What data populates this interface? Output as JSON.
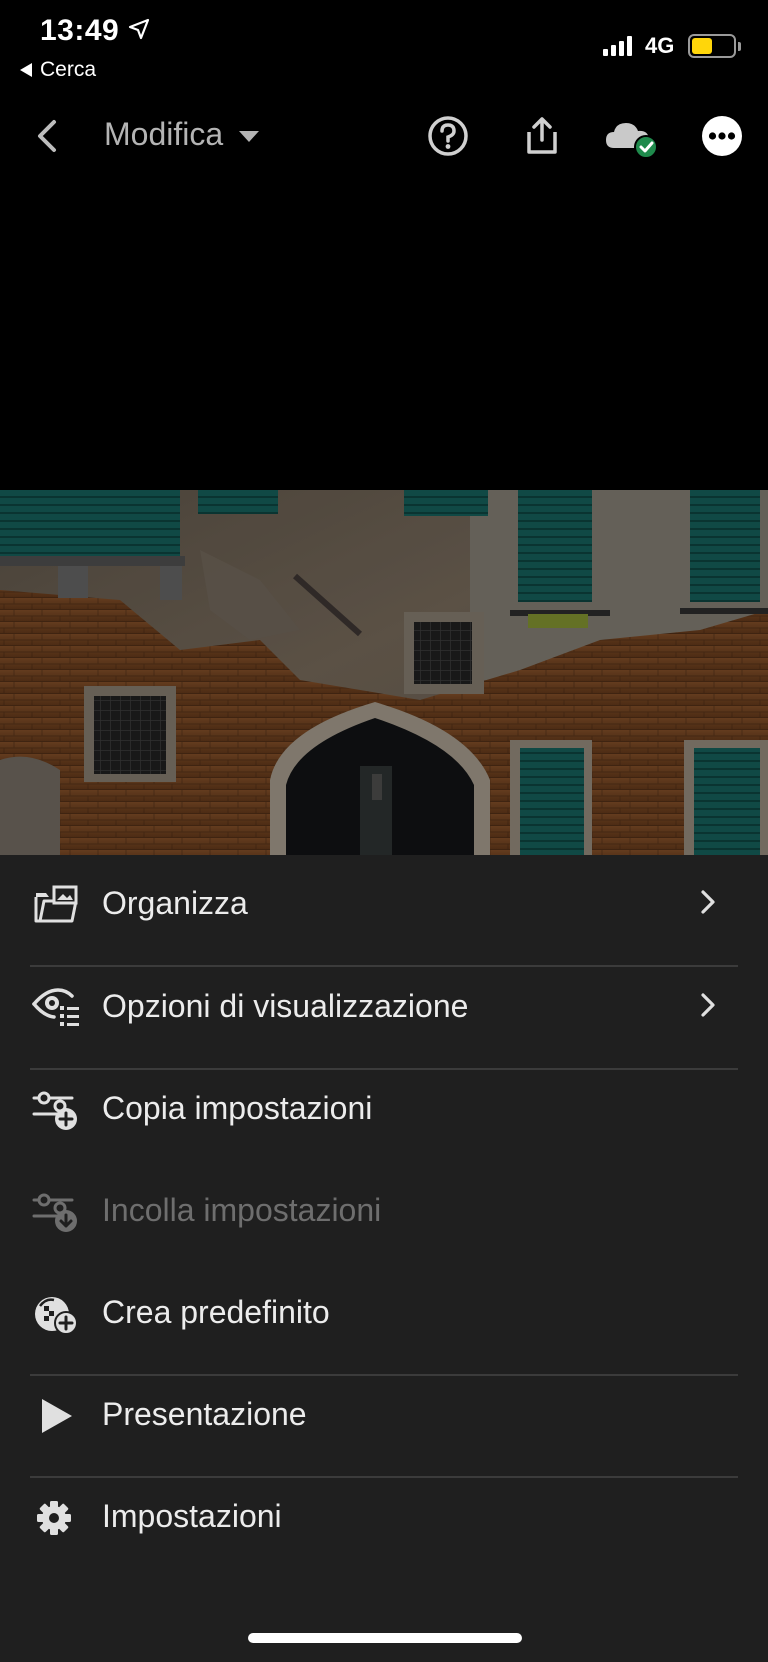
{
  "status_bar": {
    "time": "13:49",
    "back_label": "Cerca",
    "network": "4G",
    "battery_level": 0.5,
    "battery_color": "#ffd60a"
  },
  "toolbar": {
    "title": "Modifica",
    "icons": [
      "back-icon",
      "help-icon",
      "share-icon",
      "cloud-synced-icon",
      "more-icon"
    ]
  },
  "menu": {
    "items": [
      {
        "label": "Organizza",
        "icon": "folder-photos-icon",
        "has_chevron": true,
        "enabled": true
      },
      {
        "label": "Opzioni di visualizzazione",
        "icon": "view-options-icon",
        "has_chevron": true,
        "enabled": true
      },
      {
        "label": "Copia impostazioni",
        "icon": "copy-settings-icon",
        "has_chevron": false,
        "enabled": true
      },
      {
        "label": "Incolla impostazioni",
        "icon": "paste-settings-icon",
        "has_chevron": false,
        "enabled": false
      },
      {
        "label": "Crea predefinito",
        "icon": "create-preset-icon",
        "has_chevron": false,
        "enabled": true
      },
      {
        "label": "Presentazione",
        "icon": "play-icon",
        "has_chevron": false,
        "enabled": true
      },
      {
        "label": "Impostazioni",
        "icon": "gear-icon",
        "has_chevron": false,
        "enabled": true
      }
    ]
  },
  "colors": {
    "background": "#000000",
    "sheet": "#1f1f1f",
    "text": "#ececec",
    "disabled_text": "#6e6e6e",
    "sync_check": "#1f8a4c"
  }
}
